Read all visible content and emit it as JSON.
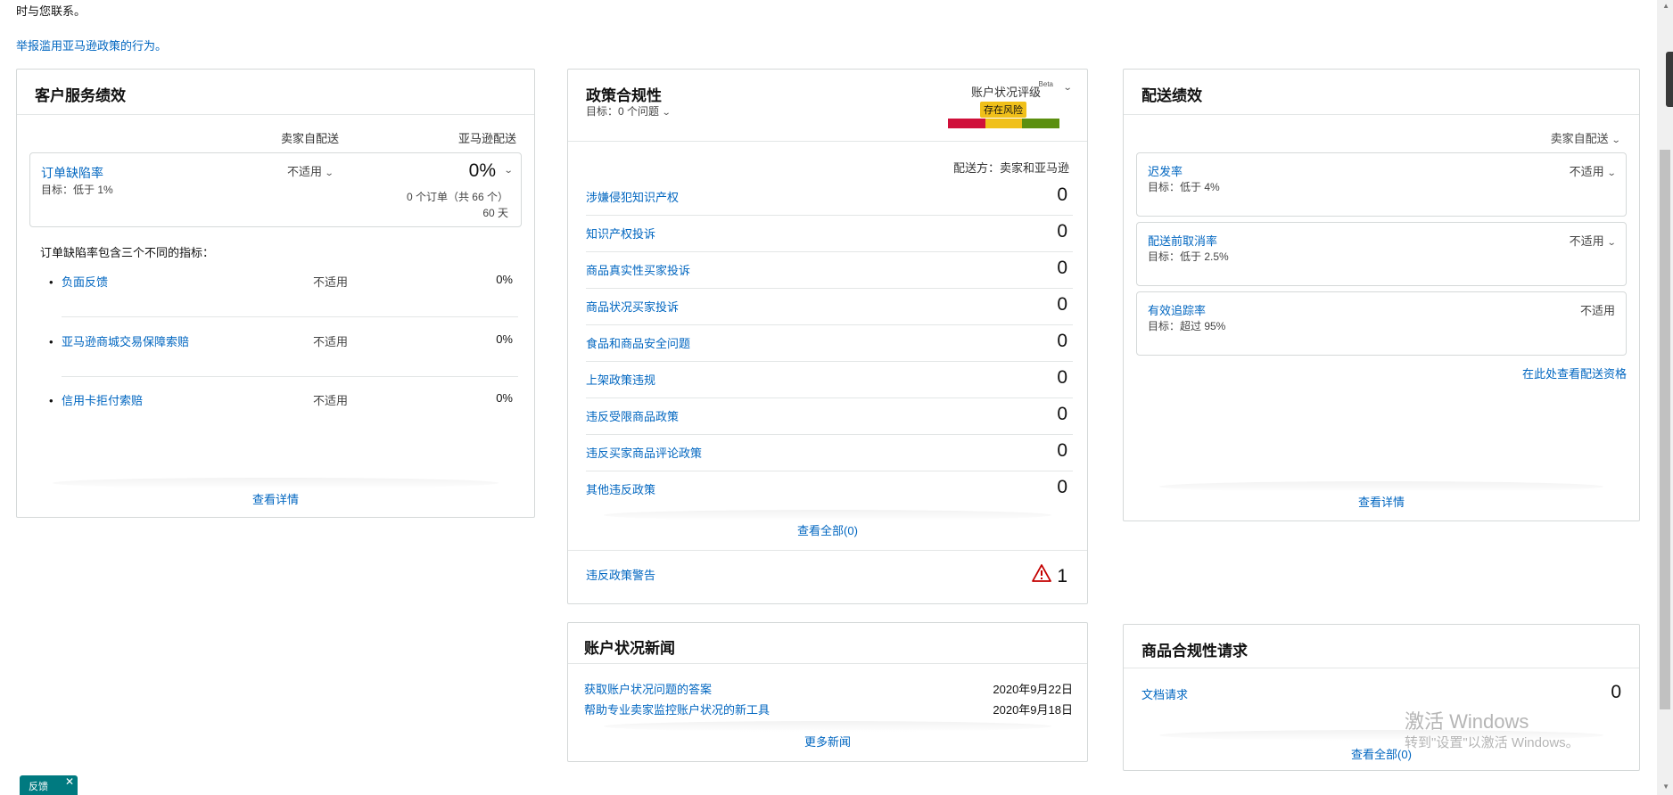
{
  "top": {
    "contact_text": "时与您联系。",
    "report_link": "举报滥用亚马逊政策的行为。"
  },
  "customer_service": {
    "title": "客户服务绩效",
    "col_seller": "卖家自配送",
    "col_amazon": "亚马逊配送",
    "odr": {
      "name": "订单缺陷率",
      "target": "目标：低于 1%",
      "seller_value": "不适用",
      "amazon_value": "0%",
      "orders": "0 个订单（共 66 个）",
      "days": "60 天"
    },
    "intro": "订单缺陷率包含三个不同的指标：",
    "metrics": [
      {
        "name": "负面反馈",
        "seller": "不适用",
        "amazon": "0%"
      },
      {
        "name": "亚马逊商城交易保障索赔",
        "seller": "不适用",
        "amazon": "0%"
      },
      {
        "name": "信用卡拒付索赔",
        "seller": "不适用",
        "amazon": "0%"
      }
    ],
    "view_details": "查看详情"
  },
  "policy": {
    "title": "政策合规性",
    "target": "目标：0 个问题",
    "ahr_label": "账户状况评级",
    "ahr_beta": "Beta",
    "ahr_status": "存在风险",
    "ahr_colors": [
      "#d0103a",
      "#f0c01a",
      "#5b8f10"
    ],
    "ship_by": "配送方：卖家和亚马逊",
    "rows": [
      {
        "name": "涉嫌侵犯知识产权",
        "value": "0"
      },
      {
        "name": "知识产权投诉",
        "value": "0"
      },
      {
        "name": "商品真实性买家投诉",
        "value": "0"
      },
      {
        "name": "商品状况买家投诉",
        "value": "0"
      },
      {
        "name": "食品和商品安全问题",
        "value": "0"
      },
      {
        "name": "上架政策违规",
        "value": "0"
      },
      {
        "name": "违反受限商品政策",
        "value": "0"
      },
      {
        "name": "违反买家商品评论政策",
        "value": "0"
      },
      {
        "name": "其他违反政策",
        "value": "0"
      }
    ],
    "view_all": "查看全部(0)",
    "warnings_label": "违反政策警告",
    "warnings_value": "1"
  },
  "delivery": {
    "title": "配送绩效",
    "seller_label": "卖家自配送",
    "metrics": [
      {
        "name": "迟发率",
        "target": "目标：低于 4%",
        "value": "不适用"
      },
      {
        "name": "配送前取消率",
        "target": "目标：低于 2.5%",
        "value": "不适用"
      },
      {
        "name": "有效追踪率",
        "target": "目标：超过 95%",
        "value": "不适用"
      }
    ],
    "qualification_link": "在此处查看配送资格",
    "view_details": "查看详情"
  },
  "news": {
    "title": "账户状况新闻",
    "items": [
      {
        "title": "获取账户状况问题的答案",
        "date": "2020年9月22日"
      },
      {
        "title": "帮助专业卖家监控账户状况的新工具",
        "date": "2020年9月18日"
      }
    ],
    "more": "更多新闻"
  },
  "product_compliance": {
    "title": "商品合规性请求",
    "doc_label": "文档请求",
    "doc_value": "0",
    "view_all": "查看全部(0)"
  },
  "watermark": {
    "line1": "激活 Windows",
    "line2": "转到\"设置\"以激活 Windows。"
  },
  "feedback": {
    "label": "反馈",
    "close": "✕"
  }
}
